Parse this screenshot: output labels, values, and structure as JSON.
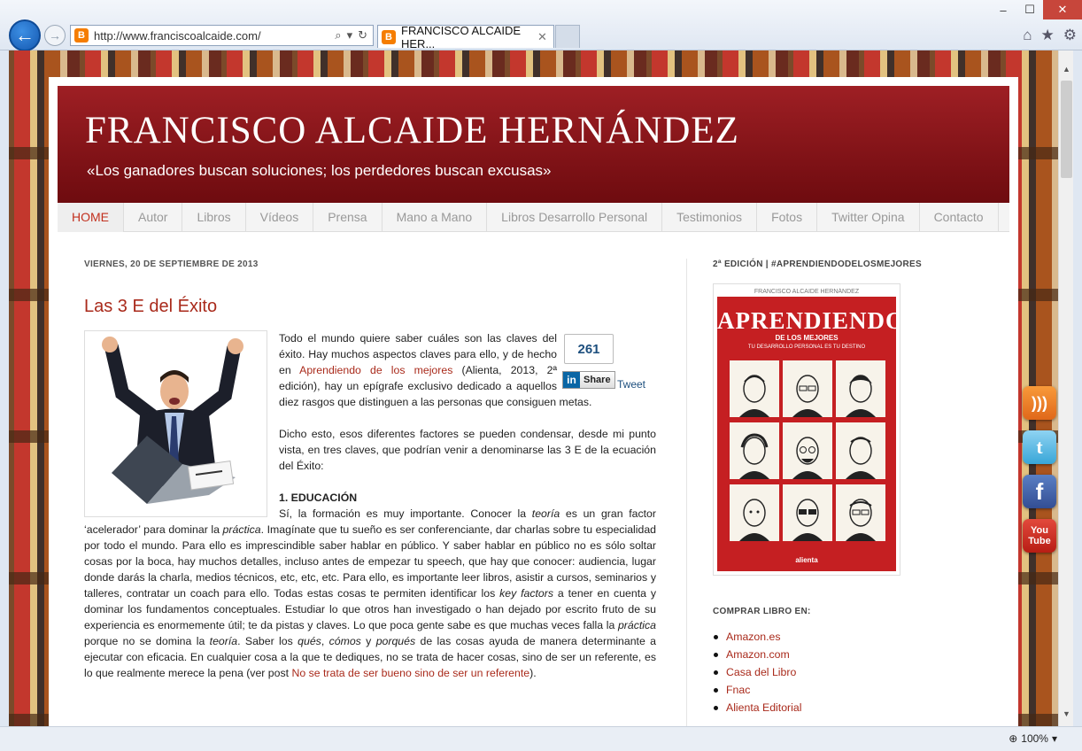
{
  "browser": {
    "url": "http://www.franciscoalcaide.com/",
    "tab_title": "FRANCISCO ALCAIDE HER...",
    "favicon": "B",
    "zoom": "100%"
  },
  "site": {
    "title": "FRANCISCO ALCAIDE HERNÁNDEZ",
    "description": "«Los ganadores buscan soluciones; los perdedores buscan excusas»"
  },
  "menu": [
    "HOME",
    "Autor",
    "Libros",
    "Vídeos",
    "Prensa",
    "Mano a Mano",
    "Libros Desarrollo Personal",
    "Testimonios",
    "Fotos",
    "Twitter Opina",
    "Contacto"
  ],
  "post": {
    "date": "VIERNES, 20 DE SEPTIEMBRE DE 2013",
    "title": "Las 3 E del Éxito",
    "p1_a": "Todo el mundo quiere saber cuáles son las claves del éxito. Hay muchos aspectos claves para ello, y de hecho en ",
    "p1_link": "Aprendiendo de los mejores",
    "p1_b": " (Alienta, 2013, 2ª edición), hay un epígrafe exclusivo dedicado a aquellos diez rasgos que distinguen a las personas que consiguen metas.",
    "p2": "Dicho esto, esos diferentes factores se pueden condensar, desde mi punto vista, en tres claves, que podrían venir a denominarse las 3 E de la ecuación del Éxito:",
    "h1": "1. EDUCACIÓN",
    "p3_a": "Sí, la formación es muy importante. Conocer la ",
    "p3_i1": "teoría",
    "p3_b": " es un gran factor ‘acelerador’ para dominar la ",
    "p3_i2": "práctica",
    "p3_c": ". Imagínate que tu sueño es ser conferenciante, dar charlas sobre tu especialidad por todo el mundo. Para ello es imprescindible saber hablar en público. Y saber hablar en público no es sólo soltar cosas por la boca, hay muchos detalles, incluso antes de empezar tu speech, que hay que conocer: audiencia, lugar donde darás la charla, medios técnicos, etc, etc, etc. Para ello, es importante leer libros, asistir a cursos, seminarios y talleres, contratar un coach para ello. Todas estas cosas te permiten identificar los ",
    "p3_i3": "key factors",
    "p3_d": " a tener en cuenta y dominar los fundamentos conceptuales. Estudiar lo que otros han investigado o han dejado por escrito fruto de su experiencia es enormemente útil; te da pistas y claves. Lo que poca gente sabe es que muchas veces falla la ",
    "p3_i4": "práctica",
    "p3_e": " porque no se domina la ",
    "p3_i5": "teoría",
    "p3_f": ". Saber los ",
    "p3_i6": "qués",
    "p3_g": ", ",
    "p3_i7": "cómos",
    "p3_h": " y ",
    "p3_i8": "porqués",
    "p3_j": " de las cosas ayuda de manera determinante a ejecutar con eficacia. En cualquier cosa a la que te dediques, no se trata de hacer cosas, sino de ser un referente, es lo que realmente merece la pena (ver post ",
    "p3_link": "No se trata de ser bueno sino de ser un referente",
    "p3_k": ")."
  },
  "share": {
    "count": "261",
    "linkedin_label": "Share",
    "tweet_label": "Tweet"
  },
  "sidebar": {
    "book_heading": "2ª EDICIÓN | #APRENDIENDODELOSMEJORES",
    "book": {
      "author": "FRANCISCO ALCAIDE HERNÁNDEZ",
      "title": "APRENDIENDO",
      "subtitle": "DE LOS MEJORES",
      "tagline": "TU DESARROLLO PERSONAL ES TU DESTINO",
      "publisher": "alienta"
    },
    "buy_heading": "COMPRAR LIBRO EN:",
    "buy_links": [
      "Amazon.es",
      "Amazon.com",
      "Casa del Libro",
      "Fnac",
      "Alienta Editorial"
    ]
  },
  "social": {
    "youtube_top": "You",
    "youtube_bottom": "Tube"
  },
  "colors": {
    "header": "#8b1519",
    "link": "#a92a1b",
    "menu_active": "#c2301e"
  }
}
